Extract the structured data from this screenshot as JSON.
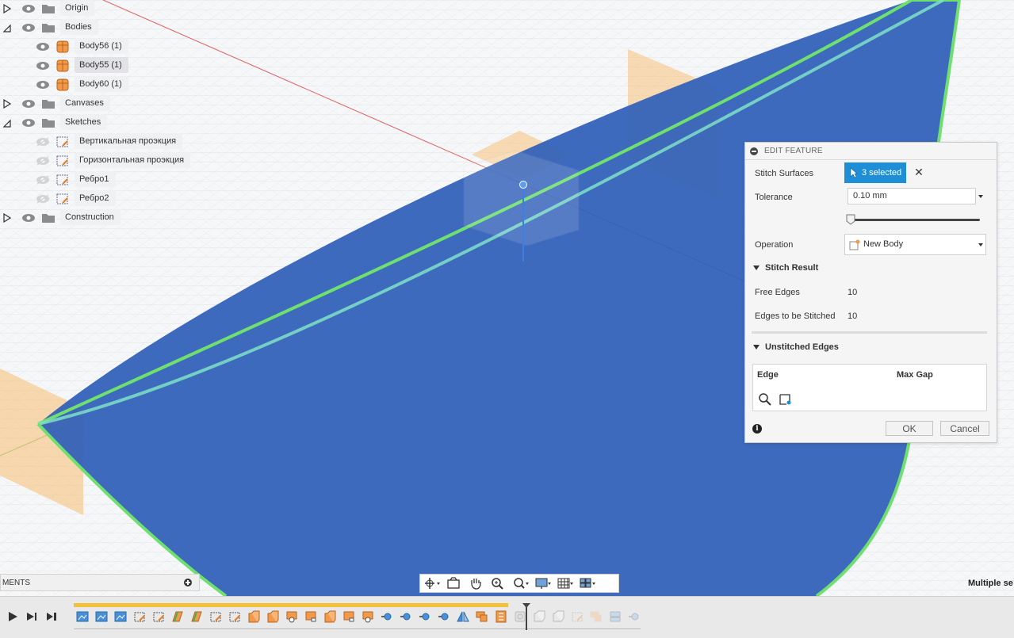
{
  "browser": {
    "items": [
      {
        "label": "Origin"
      },
      {
        "label": "Bodies"
      },
      {
        "label": "Body56 (1)"
      },
      {
        "label": "Body55 (1)"
      },
      {
        "label": "Body60 (1)"
      },
      {
        "label": "Canvases"
      },
      {
        "label": "Sketches"
      },
      {
        "label": "Вертикальная проэкция"
      },
      {
        "label": "Горизонтальная проэкция"
      },
      {
        "label": "Ребро1"
      },
      {
        "label": "Ребро2"
      },
      {
        "label": "Construction"
      }
    ]
  },
  "dialog": {
    "title": "EDIT FEATURE",
    "stitch_surfaces_label": "Stitch Surfaces",
    "selected_label": "3 selected",
    "tolerance_label": "Tolerance",
    "tolerance_value": "0.10 mm",
    "operation_label": "Operation",
    "operation_value": "New Body",
    "stitch_result_heading": "Stitch Result",
    "free_edges_label": "Free Edges",
    "free_edges_value": "10",
    "edges_to_stitch_label": "Edges to be Stitched",
    "edges_to_stitch_value": "10",
    "unstitched_heading": "Unstitched Edges",
    "col_edge": "Edge",
    "col_max_gap": "Max Gap",
    "ok_label": "OK",
    "cancel_label": "Cancel"
  },
  "comments": {
    "label": "MENTS"
  },
  "status": {
    "text": "Multiple se"
  },
  "colors": {
    "accent": "#1e8fd6",
    "surface": "#2f5fb8",
    "edge_highlight": "#6fe06f",
    "plane": "#f8c27a"
  }
}
